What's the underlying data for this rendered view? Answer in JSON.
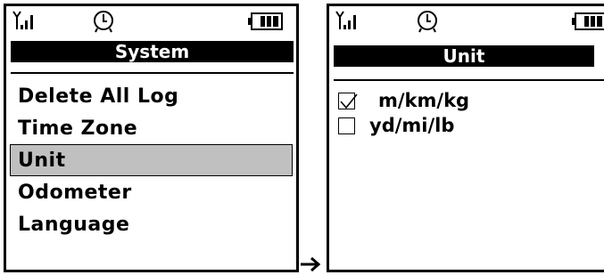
{
  "left_screen": {
    "title": "System",
    "menu": [
      {
        "label": "Delete All Log",
        "selected": false
      },
      {
        "label": "Time Zone",
        "selected": false
      },
      {
        "label": "Unit",
        "selected": true
      },
      {
        "label": "Odometer",
        "selected": false
      },
      {
        "label": "Language",
        "selected": false
      }
    ]
  },
  "right_screen": {
    "title": "Unit",
    "options": [
      {
        "label": "m/km/kg",
        "checked": true
      },
      {
        "label": "yd/mi/lb",
        "checked": false
      }
    ]
  },
  "icons": {
    "signal": "signal-strength-icon",
    "alarm": "alarm-clock-icon",
    "battery": "battery-full-icon",
    "arrow": "right-arrow-icon",
    "check": "checkmark-icon"
  }
}
